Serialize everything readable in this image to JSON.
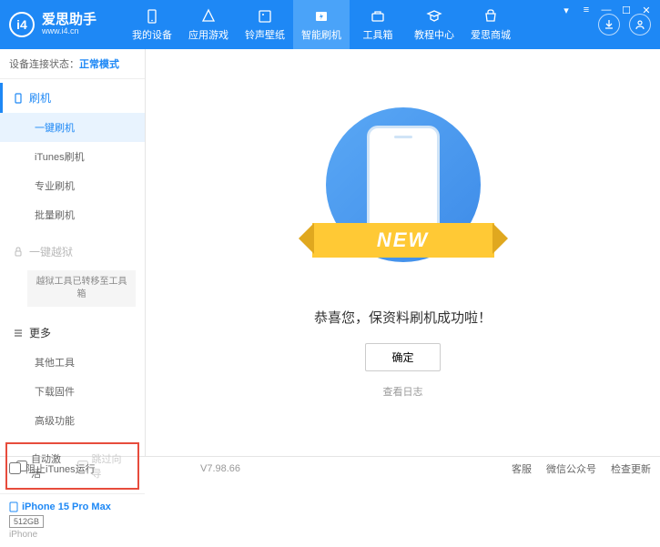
{
  "app": {
    "title": "爱思助手",
    "url": "www.i4.cn",
    "logo_letter": "i4"
  },
  "nav": [
    {
      "label": "我的设备",
      "icon": "device"
    },
    {
      "label": "应用游戏",
      "icon": "apps"
    },
    {
      "label": "铃声壁纸",
      "icon": "media"
    },
    {
      "label": "智能刷机",
      "icon": "flash",
      "active": true
    },
    {
      "label": "工具箱",
      "icon": "tools"
    },
    {
      "label": "教程中心",
      "icon": "tutorial"
    },
    {
      "label": "爱思商城",
      "icon": "shop"
    }
  ],
  "status": {
    "label": "设备连接状态：",
    "value": "正常模式"
  },
  "sidebar": {
    "flash_section": "刷机",
    "flash_items": [
      "一键刷机",
      "iTunes刷机",
      "专业刷机",
      "批量刷机"
    ],
    "jailbreak_section": "一键越狱",
    "jailbreak_note": "越狱工具已转移至工具箱",
    "more_section": "更多",
    "more_items": [
      "其他工具",
      "下载固件",
      "高级功能"
    ]
  },
  "checkboxes": {
    "auto_activate": "自动激活",
    "skip_setup": "跳过向导"
  },
  "device": {
    "name": "iPhone 15 Pro Max",
    "storage": "512GB",
    "type": "iPhone"
  },
  "main": {
    "banner": "NEW",
    "message": "恭喜您，保资料刷机成功啦！",
    "ok": "确定",
    "view_log": "查看日志"
  },
  "footer": {
    "block_itunes": "阻止iTunes运行",
    "version": "V7.98.66",
    "links": [
      "客服",
      "微信公众号",
      "检查更新"
    ]
  }
}
